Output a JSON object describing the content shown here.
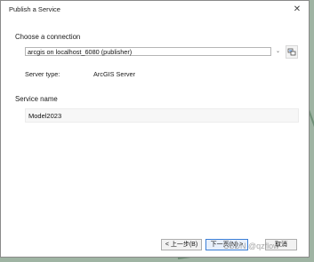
{
  "window": {
    "title": "Publish a Service",
    "close_glyph": "✕"
  },
  "connection": {
    "section_label": "Choose a connection",
    "selected": "arcgis on localhost_6080 (publisher)",
    "dropdown_glyph": "⌄",
    "server_type_label": "Server type:",
    "server_type_value": "ArcGIS Server"
  },
  "service": {
    "section_label": "Service name",
    "name_value": "Model2023"
  },
  "footer": {
    "back_label": "< 上一步(B)",
    "next_label": "下一页(N) >",
    "cancel_label": "取消"
  },
  "watermark": "CSDN @qzflow",
  "icons": {
    "close": "close-icon",
    "dropdown": "chevron-down-icon",
    "connection": "add-connection-icon"
  },
  "colors": {
    "accent": "#3c7fd6",
    "backdrop": "#9fb4a3"
  }
}
